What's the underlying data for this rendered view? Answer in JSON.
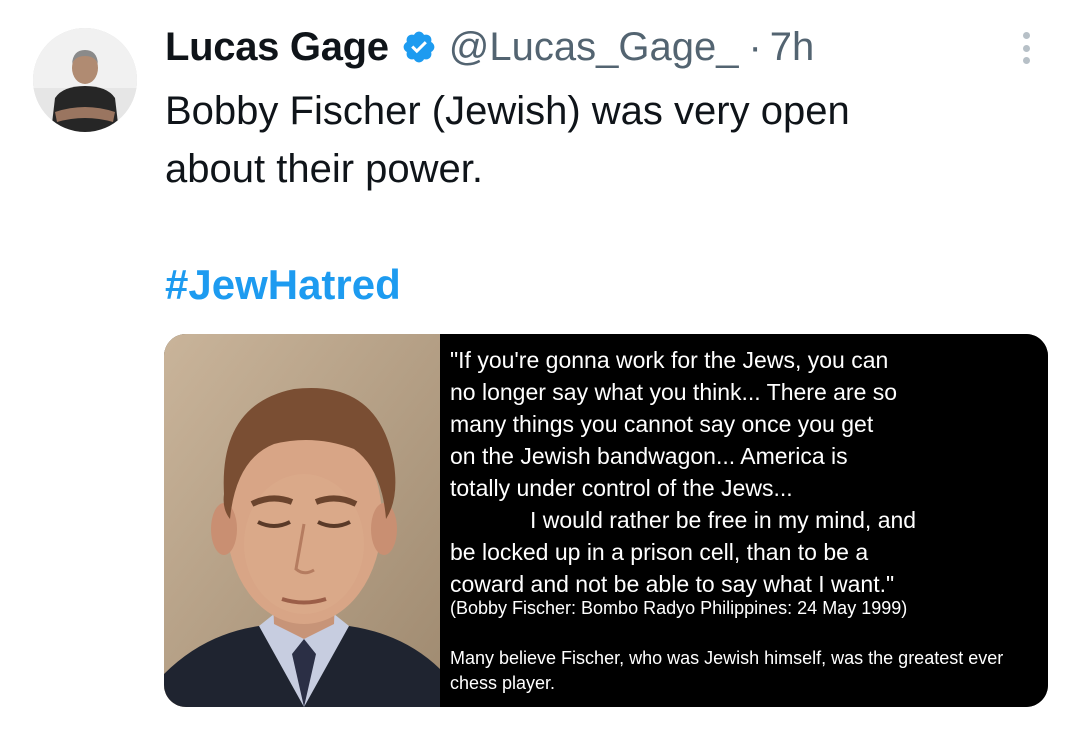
{
  "tweet": {
    "author": {
      "display_name": "Lucas Gage",
      "handle": "@Lucas_Gage_",
      "verified_icon": "verified-badge-icon",
      "avatar_icon": "avatar"
    },
    "separator": "·",
    "time": "7h",
    "more_icon": "more-options-icon",
    "text_lines": [
      "Bobby Fischer (Jewish) was very open",
      "about their power."
    ],
    "hashtag": "#JewHatred",
    "media": {
      "quote_lines": [
        "\"If you're gonna work for the Jews, you can",
        "no longer say what you think... There are so",
        "many things you cannot say once you get",
        "on the Jewish bandwagon... America is",
        "totally under control of the Jews...",
        "I would rather be free in my mind, and",
        "be locked up in a prison cell, than to be a",
        "coward and not be able to say what I want.\""
      ],
      "attribution": "(Bobby Fischer: Bombo Radyo Philippines: 24 May 1999)",
      "caption": "Many believe Fischer, who was Jewish himself, was the greatest ever chess player."
    }
  },
  "colors": {
    "text": "#0f1419",
    "secondary": "#536471",
    "link": "#1d9bf0",
    "verified": "#1d9bf0"
  }
}
